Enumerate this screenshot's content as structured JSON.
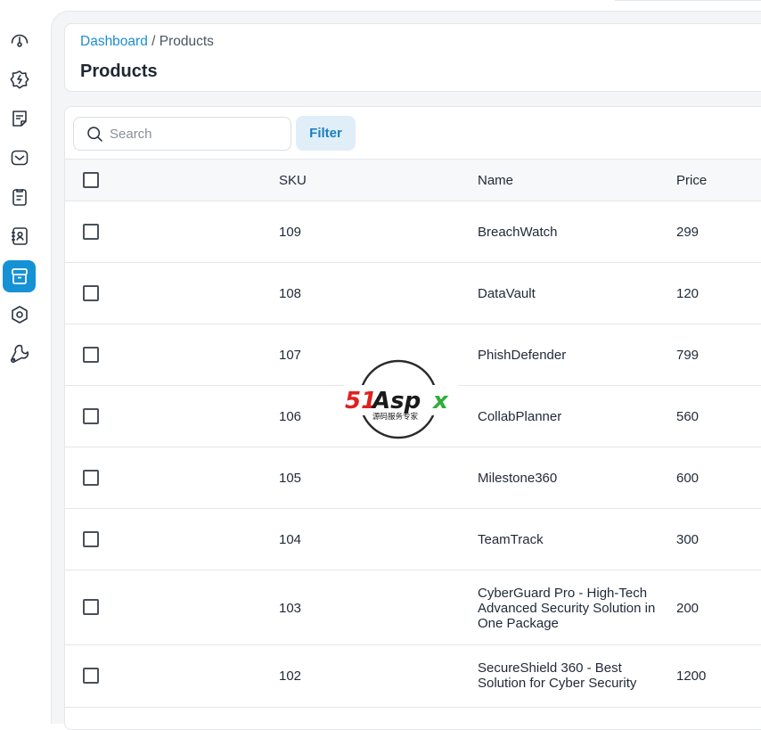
{
  "sidebar": {
    "items": [
      {
        "icon": "dashboard-gauge-icon",
        "active": false
      },
      {
        "icon": "integrations-icon",
        "active": false
      },
      {
        "icon": "notes-icon",
        "active": false
      },
      {
        "icon": "inbox-icon",
        "active": false
      },
      {
        "icon": "clipboard-icon",
        "active": false
      },
      {
        "icon": "contacts-icon",
        "active": false
      },
      {
        "icon": "products-box-icon",
        "active": true
      },
      {
        "icon": "settings-hexagon-icon",
        "active": false
      },
      {
        "icon": "wrench-icon",
        "active": false
      }
    ],
    "active_color": "#1591d6"
  },
  "breadcrumb": {
    "link": "Dashboard",
    "separator": "/",
    "current": "Products"
  },
  "page": {
    "title": "Products"
  },
  "toolbar": {
    "search_placeholder": "Search",
    "search_value": "",
    "filter_label": "Filter"
  },
  "table": {
    "columns": [
      "SKU",
      "Name",
      "Price"
    ],
    "rows": [
      {
        "sku": "109",
        "name": "BreachWatch",
        "price": "299"
      },
      {
        "sku": "108",
        "name": "DataVault",
        "price": "120"
      },
      {
        "sku": "107",
        "name": "PhishDefender",
        "price": "799"
      },
      {
        "sku": "106",
        "name": "CollabPlanner",
        "price": "560"
      },
      {
        "sku": "105",
        "name": "Milestone360",
        "price": "600"
      },
      {
        "sku": "104",
        "name": "TeamTrack",
        "price": "300"
      },
      {
        "sku": "103",
        "name": "CyberGuard Pro - High-Tech Advanced Security Solution in One Package",
        "price": "200"
      },
      {
        "sku": "102",
        "name": "SecureShield 360 - Best Solution for Cyber Security",
        "price": "1200"
      }
    ]
  },
  "watermark": {
    "text": "51Aspx",
    "subtext": "源码服务专家"
  }
}
